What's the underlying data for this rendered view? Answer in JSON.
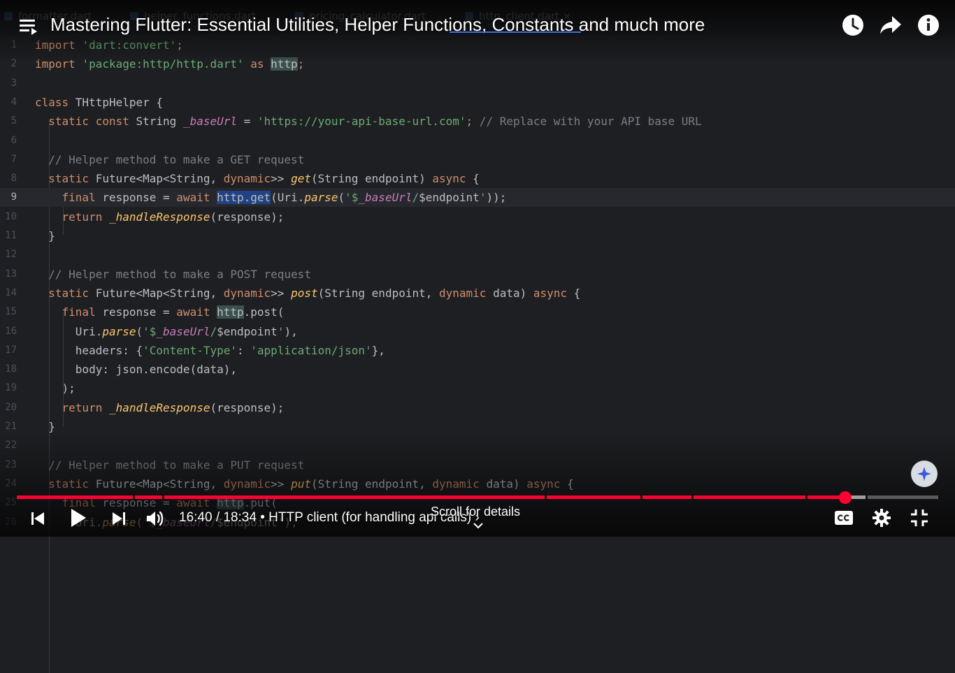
{
  "ide_tabs": [
    "formatter.dart",
    "helper_functions.dart",
    "pricing_calculator.dart",
    "http_client.dart"
  ],
  "tab_close": "×",
  "video": {
    "title": "Mastering Flutter: Essential Utilities, Helper Functions, Constants and much more",
    "time": "16:40 / 18:34",
    "separator": "•",
    "chapter": "HTTP client (for handling api calls)",
    "chapter_arrow": "›",
    "scroll_hint": "Scroll for details",
    "progress_played_percent": 89.9
  },
  "code": {
    "current_line": 9,
    "lines": [
      {
        "n": "1",
        "spans": [
          [
            "kw",
            "import "
          ],
          [
            "str",
            "'dart:convert'"
          ],
          [
            "kw",
            ";"
          ]
        ]
      },
      {
        "n": "2",
        "spans": [
          [
            "kw",
            "import "
          ],
          [
            "str",
            "'package:http/http.dart'"
          ],
          [
            "kw",
            " as "
          ],
          [
            "hl",
            "http"
          ],
          [
            "kw",
            ";"
          ]
        ]
      },
      {
        "n": "3",
        "spans": []
      },
      {
        "n": "4",
        "spans": [
          [
            "kw",
            "class "
          ],
          [
            "",
            "THttpHelper {"
          ]
        ]
      },
      {
        "n": "5",
        "spans": [
          [
            "kw",
            "  static const "
          ],
          [
            "",
            "String "
          ],
          [
            "fld",
            "_baseUrl"
          ],
          [
            "",
            " = "
          ],
          [
            "str",
            "'https://your-api-base-url.com'"
          ],
          [
            "kw",
            ";"
          ],
          [
            "cmt",
            " // Replace with your API base URL"
          ]
        ]
      },
      {
        "n": "6",
        "spans": []
      },
      {
        "n": "7",
        "spans": [
          [
            "cmt",
            "  // Helper method to make a GET request"
          ]
        ]
      },
      {
        "n": "8",
        "spans": [
          [
            "kw",
            "  static "
          ],
          [
            "",
            "Future<Map<String, "
          ],
          [
            "kw",
            "dynamic"
          ],
          [
            "",
            ">> "
          ],
          [
            "fn",
            "get"
          ],
          [
            "",
            "(String endpoint) "
          ],
          [
            "kw",
            "async"
          ],
          [
            "",
            " {"
          ]
        ]
      },
      {
        "n": "9",
        "spans": [
          [
            "kw",
            "    final "
          ],
          [
            "",
            "response = "
          ],
          [
            "kw",
            "await "
          ],
          [
            "sel",
            "http.get"
          ],
          [
            "",
            "(Uri."
          ],
          [
            "fn",
            "parse"
          ],
          [
            "",
            "("
          ],
          [
            "str",
            "'$"
          ],
          [
            "fld",
            "_baseUrl"
          ],
          [
            "str",
            "/"
          ],
          [
            "",
            "$endpoint"
          ],
          [
            "str",
            "'"
          ],
          [
            "",
            "));"
          ]
        ]
      },
      {
        "n": "10",
        "spans": [
          [
            "kw",
            "    return "
          ],
          [
            "fn",
            "_handleResponse"
          ],
          [
            "",
            "(response);"
          ]
        ]
      },
      {
        "n": "11",
        "spans": [
          [
            "",
            "  }"
          ]
        ]
      },
      {
        "n": "12",
        "spans": []
      },
      {
        "n": "13",
        "spans": [
          [
            "cmt",
            "  // Helper method to make a POST request"
          ]
        ]
      },
      {
        "n": "14",
        "spans": [
          [
            "kw",
            "  static "
          ],
          [
            "",
            "Future<Map<String, "
          ],
          [
            "kw",
            "dynamic"
          ],
          [
            "",
            ">> "
          ],
          [
            "fn",
            "post"
          ],
          [
            "",
            "(String endpoint, "
          ],
          [
            "kw",
            "dynamic "
          ],
          [
            "",
            "data) "
          ],
          [
            "kw",
            "async"
          ],
          [
            "",
            " {"
          ]
        ]
      },
      {
        "n": "15",
        "spans": [
          [
            "kw",
            "    final "
          ],
          [
            "",
            "response = "
          ],
          [
            "kw",
            "await "
          ],
          [
            "hl",
            "http"
          ],
          [
            "",
            ".post("
          ]
        ]
      },
      {
        "n": "16",
        "spans": [
          [
            "",
            "      Uri."
          ],
          [
            "fn",
            "parse"
          ],
          [
            "",
            "("
          ],
          [
            "str",
            "'$"
          ],
          [
            "fld",
            "_baseUrl"
          ],
          [
            "str",
            "/"
          ],
          [
            "",
            "$endpoint"
          ],
          [
            "str",
            "'"
          ],
          [
            "",
            "),"
          ]
        ]
      },
      {
        "n": "17",
        "spans": [
          [
            "",
            "      headers: {"
          ],
          [
            "str",
            "'Content-Type'"
          ],
          [
            "",
            ": "
          ],
          [
            "str",
            "'application/json'"
          ],
          [
            "",
            "},"
          ]
        ]
      },
      {
        "n": "18",
        "spans": [
          [
            "",
            "      body: json.encode(data),"
          ]
        ]
      },
      {
        "n": "19",
        "spans": [
          [
            "",
            "    );"
          ]
        ]
      },
      {
        "n": "20",
        "spans": [
          [
            "kw",
            "    return "
          ],
          [
            "fn",
            "_handleResponse"
          ],
          [
            "",
            "(response);"
          ]
        ]
      },
      {
        "n": "21",
        "spans": [
          [
            "",
            "  }"
          ]
        ]
      },
      {
        "n": "22",
        "spans": []
      },
      {
        "n": "23",
        "spans": [
          [
            "cmt",
            "  // Helper method to make a PUT request"
          ]
        ]
      },
      {
        "n": "24",
        "spans": [
          [
            "kw",
            "  static "
          ],
          [
            "",
            "Future<Map<String, "
          ],
          [
            "kw",
            "dynamic"
          ],
          [
            "",
            ">> "
          ],
          [
            "fn",
            "put"
          ],
          [
            "",
            "(String endpoint, "
          ],
          [
            "kw",
            "dynamic "
          ],
          [
            "",
            "data) "
          ],
          [
            "kw",
            "async"
          ],
          [
            "",
            " {"
          ]
        ]
      },
      {
        "n": "25",
        "spans": [
          [
            "kw",
            "    final "
          ],
          [
            "",
            "response = "
          ],
          [
            "kw",
            "await "
          ],
          [
            "hl",
            "http"
          ],
          [
            "",
            ".put("
          ]
        ]
      },
      {
        "n": "26",
        "spans": [
          [
            "",
            "      Uri."
          ],
          [
            "fn",
            "parse"
          ],
          [
            "",
            "("
          ],
          [
            "str",
            "'$"
          ],
          [
            "fld",
            "_baseUrl"
          ],
          [
            "str",
            "/"
          ],
          [
            "",
            "$endpoint"
          ],
          [
            "str",
            "'"
          ],
          [
            "",
            "),"
          ]
        ]
      }
    ]
  },
  "colors": {
    "progress_played": "#ff0033",
    "progress_loaded": "#a0a0a0",
    "progress_track": "#5a5a5a",
    "editor_bg": "#1e1f22"
  },
  "icons": {
    "menu": "playlist-menu-icon",
    "watch_later": "clock-icon",
    "share": "share-arrow-icon",
    "info": "info-icon",
    "previous": "skip-previous-icon",
    "play": "play-icon",
    "next": "skip-next-icon",
    "volume": "volume-icon",
    "captions": "closed-captions-icon",
    "settings": "gear-icon",
    "exit_fullscreen": "exit-fullscreen-icon"
  }
}
